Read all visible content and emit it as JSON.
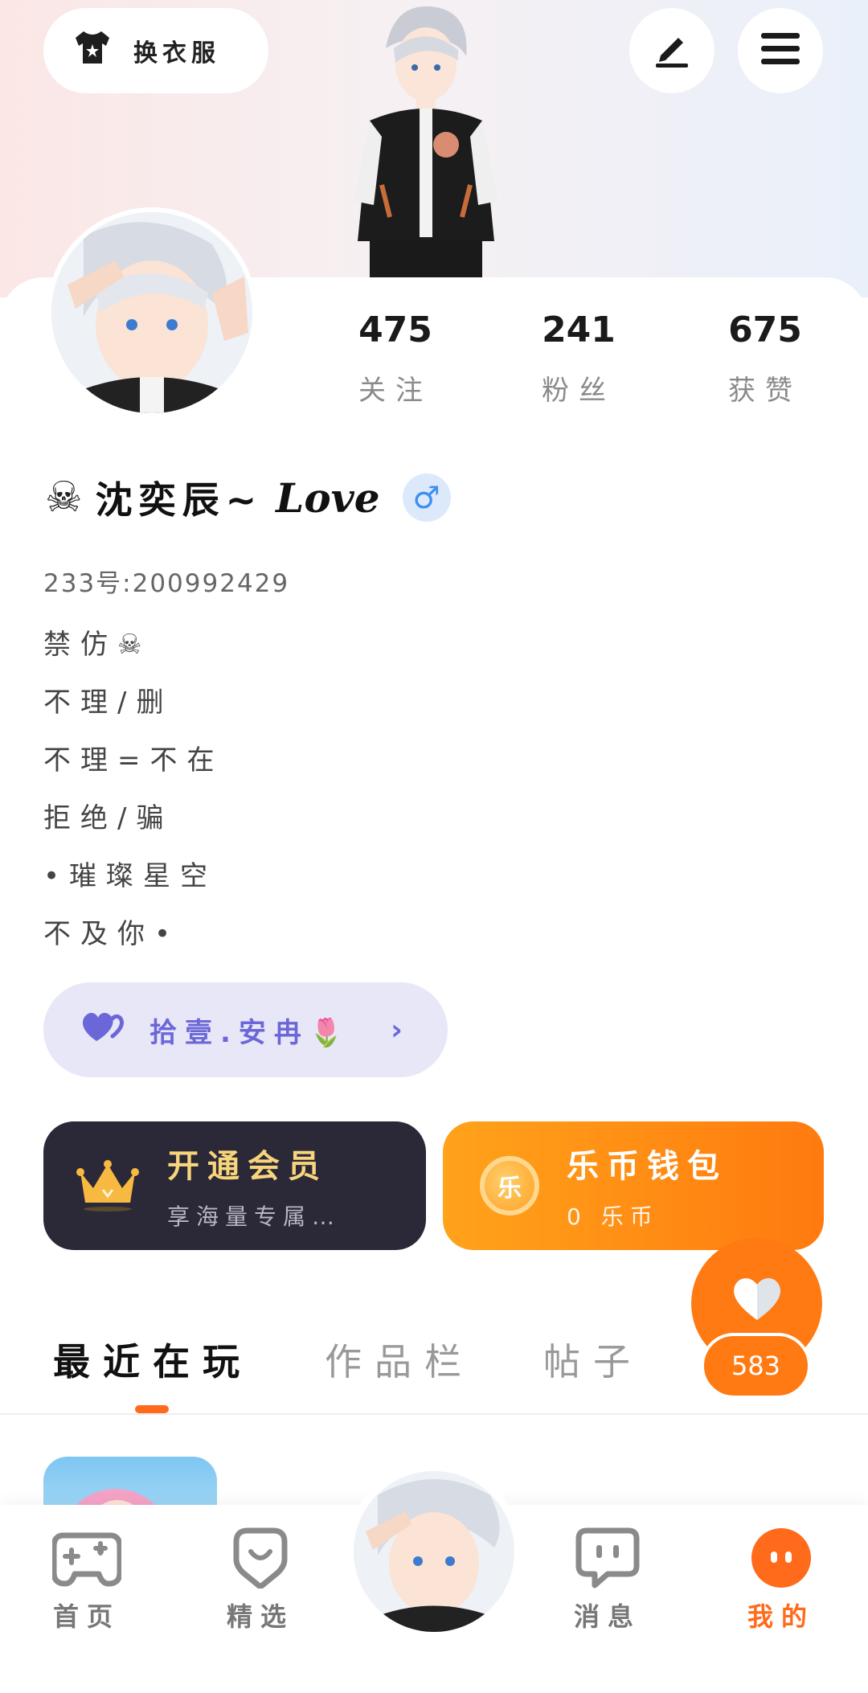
{
  "header": {
    "outfit_label": "换衣服"
  },
  "stats": [
    {
      "value": "475",
      "label": "关注"
    },
    {
      "value": "241",
      "label": "粉丝"
    },
    {
      "value": "675",
      "label": "获赞"
    }
  ],
  "profile": {
    "name": "沈奕辰~",
    "name_signature": "Love",
    "gender_symbol": "♂",
    "uid": "233号:200992429",
    "bio": [
      "禁仿☠",
      "不理/删",
      "不理=不在",
      "拒绝/骗",
      "•璀璨星空",
      "不及你•"
    ]
  },
  "relation": {
    "label": "拾壹.安冉🌷"
  },
  "vip": {
    "title": "开通会员",
    "subtitle": "享海量专属…"
  },
  "wallet": {
    "title": "乐币钱包",
    "subtitle": "0 乐币",
    "coin_glyph": "乐"
  },
  "likes": {
    "count": "583"
  },
  "tabs": [
    {
      "label": "最近在玩",
      "active": true
    },
    {
      "label": "作品栏",
      "active": false
    },
    {
      "label": "帖子",
      "active": false
    }
  ],
  "bottom_nav": [
    {
      "label": "首页",
      "icon": "gamepad-icon",
      "active": false
    },
    {
      "label": "精选",
      "icon": "heart-badge-icon",
      "active": false
    },
    {
      "label": "消息",
      "icon": "chat-bubble-icon",
      "active": false
    },
    {
      "label": "我的",
      "icon": "profile-dots-icon",
      "active": true
    }
  ],
  "colors": {
    "accent": "#ff7a12",
    "vip_bg": "#2b2938",
    "relation_bg": "#e7e7f8",
    "gender_blue": "#3d8ff0"
  }
}
